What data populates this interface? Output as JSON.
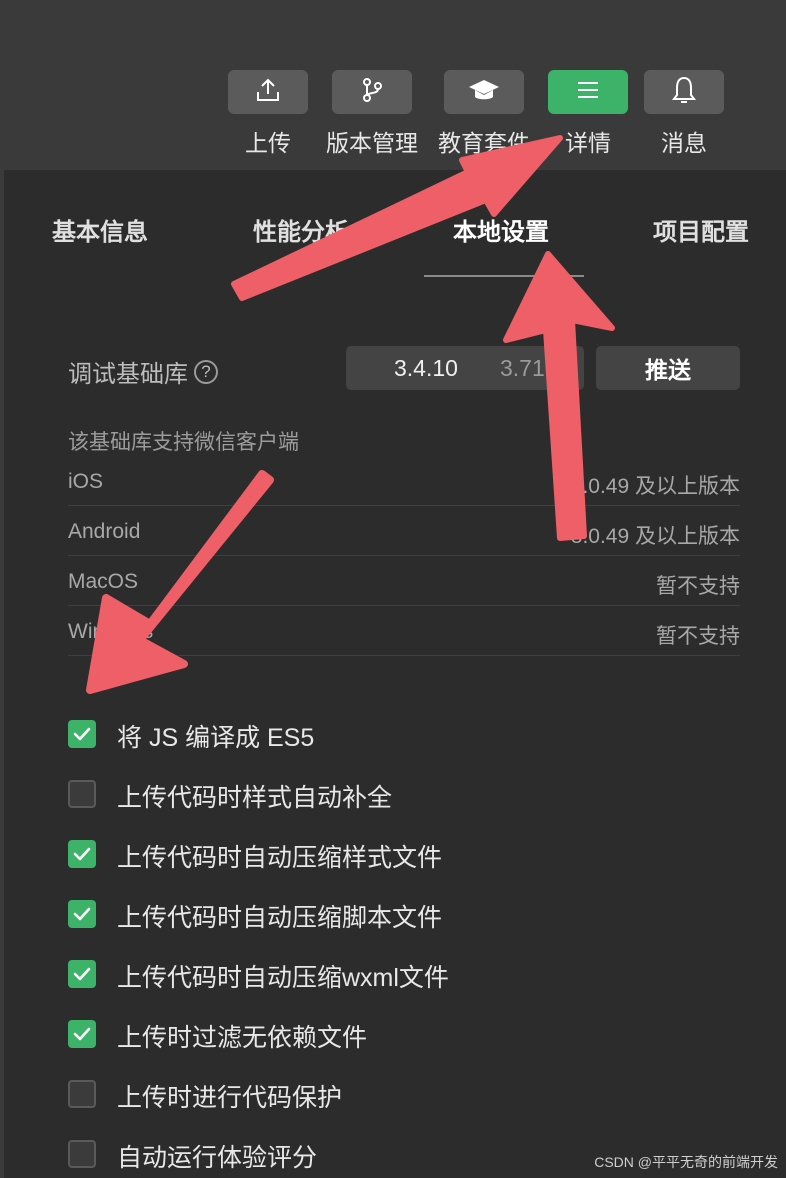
{
  "toolbar": {
    "items": [
      {
        "label": "上传",
        "icon": "upload-icon"
      },
      {
        "label": "版本管理",
        "icon": "branch-icon"
      },
      {
        "label": "教育套件",
        "icon": "graduation-cap-icon"
      },
      {
        "label": "详情",
        "icon": "menu-lines-icon",
        "active": true
      },
      {
        "label": "消息",
        "icon": "bell-icon"
      }
    ]
  },
  "tabs": [
    {
      "label": "基本信息"
    },
    {
      "label": "性能分析"
    },
    {
      "label": "本地设置",
      "active": true
    },
    {
      "label": "项目配置"
    }
  ],
  "debug_lib": {
    "label": "调试基础库",
    "help_icon": "question-circle-icon",
    "current_version": "3.4.10",
    "next_version": "3.71",
    "push_label": "推送"
  },
  "support": {
    "title": "该基础库支持微信客户端",
    "rows": [
      {
        "os": "iOS",
        "version": "8.0.49 及以上版本"
      },
      {
        "os": "Android",
        "version": "8.0.49 及以上版本"
      },
      {
        "os": "MacOS",
        "version": "暂不支持"
      },
      {
        "os": "Windows",
        "version": "暂不支持"
      }
    ]
  },
  "options": [
    {
      "label": "将 JS 编译成 ES5",
      "checked": true
    },
    {
      "label": "上传代码时样式自动补全",
      "checked": false
    },
    {
      "label": "上传代码时自动压缩样式文件",
      "checked": true
    },
    {
      "label": "上传代码时自动压缩脚本文件",
      "checked": true
    },
    {
      "label": "上传代码时自动压缩wxml文件",
      "checked": true
    },
    {
      "label": "上传时过滤无依赖文件",
      "checked": true
    },
    {
      "label": "上传时进行代码保护",
      "checked": false
    },
    {
      "label": "自动运行体验评分",
      "checked": false
    }
  ],
  "watermark": "CSDN @平平无奇的前端开发",
  "colors": {
    "accent_green": "#3db36a",
    "arrow_red": "#ee5f67",
    "background": "#2c2c2c"
  }
}
